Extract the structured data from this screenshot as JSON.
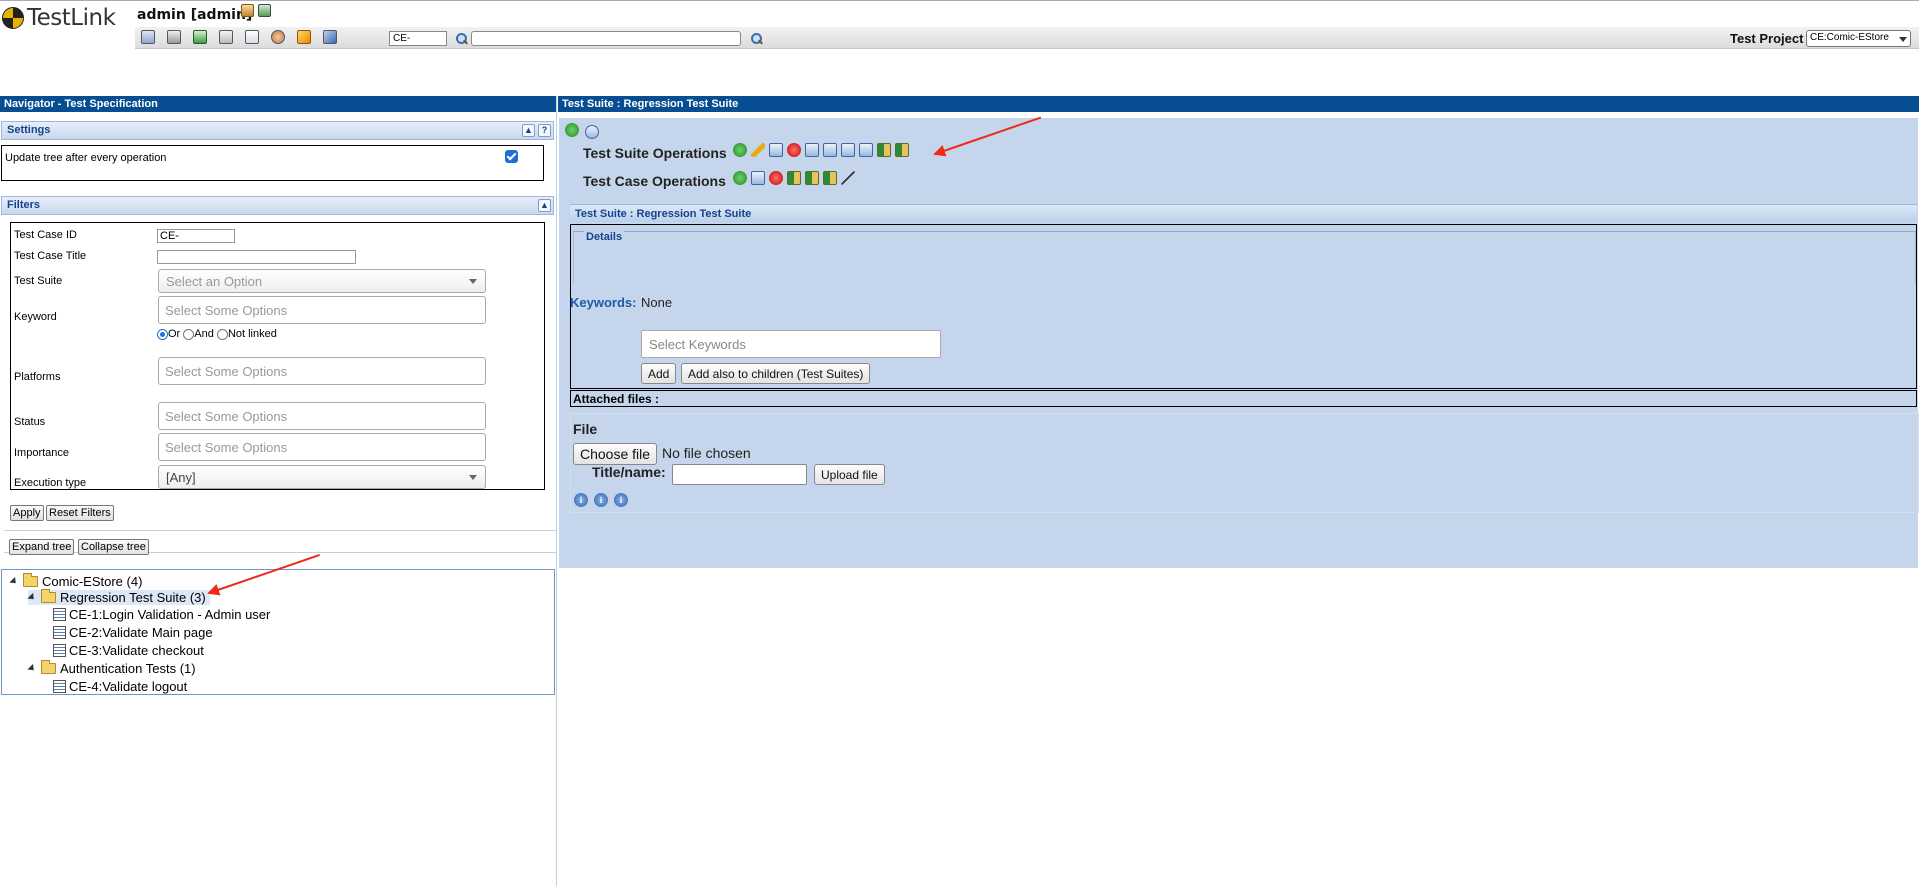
{
  "header": {
    "logo_text": "TestLink",
    "user": "admin [admin]",
    "tc_search_value": "CE-",
    "full_search_value": "",
    "test_project_label": "Test Project",
    "test_project_value": "CE:Comic-EStore"
  },
  "navigator": {
    "title": "Navigator - Test Specification",
    "settings": {
      "title": "Settings",
      "update_tree_label": "Update tree after every operation",
      "update_tree_checked": true
    },
    "filters": {
      "title": "Filters",
      "test_case_id_label": "Test Case ID",
      "test_case_id_value": "CE-",
      "test_case_title_label": "Test Case Title",
      "test_case_title_value": "",
      "test_suite_label": "Test Suite",
      "test_suite_placeholder": "Select an Option",
      "keyword_label": "Keyword",
      "keyword_placeholder": "Select Some Options",
      "keyword_modes": [
        "Or",
        "And",
        "Not linked"
      ],
      "keyword_mode_selected": "Or",
      "platforms_label": "Platforms",
      "platforms_placeholder": "Select Some Options",
      "status_label": "Status",
      "status_placeholder": "Select Some Options",
      "importance_label": "Importance",
      "importance_placeholder": "Select Some Options",
      "execution_type_label": "Execution type",
      "execution_type_value": "[Any]",
      "apply_label": "Apply",
      "reset_label": "Reset Filters"
    },
    "expand_tree_label": "Expand tree",
    "collapse_tree_label": "Collapse tree",
    "tree": {
      "root": "Comic-EStore (4)",
      "suites": [
        {
          "label": "Regression Test Suite (3)",
          "cases": [
            "CE-1:Login Validation - Admin user",
            "CE-2:Validate Main page",
            "CE-3:Validate checkout"
          ]
        },
        {
          "label": "Authentication Tests (1)",
          "cases": [
            "CE-4:Validate logout"
          ]
        }
      ]
    }
  },
  "workframe": {
    "title": "Test Suite : Regression Test Suite",
    "suite_ops_label": "Test Suite Operations",
    "case_ops_label": "Test Case Operations",
    "suite_title_bar": "Test Suite : Regression Test Suite",
    "details_label": "Details",
    "keywords_label": "Keywords:",
    "keywords_value": "None",
    "keywords_placeholder": "Select Keywords",
    "add_label": "Add",
    "add_children_label": "Add also to children (Test Suites)",
    "attached_files_label": "Attached files :",
    "file_label": "File",
    "choose_file_label": "Choose file",
    "no_file_label": "No file chosen",
    "title_name_label": "Title/name:",
    "upload_label": "Upload file"
  }
}
